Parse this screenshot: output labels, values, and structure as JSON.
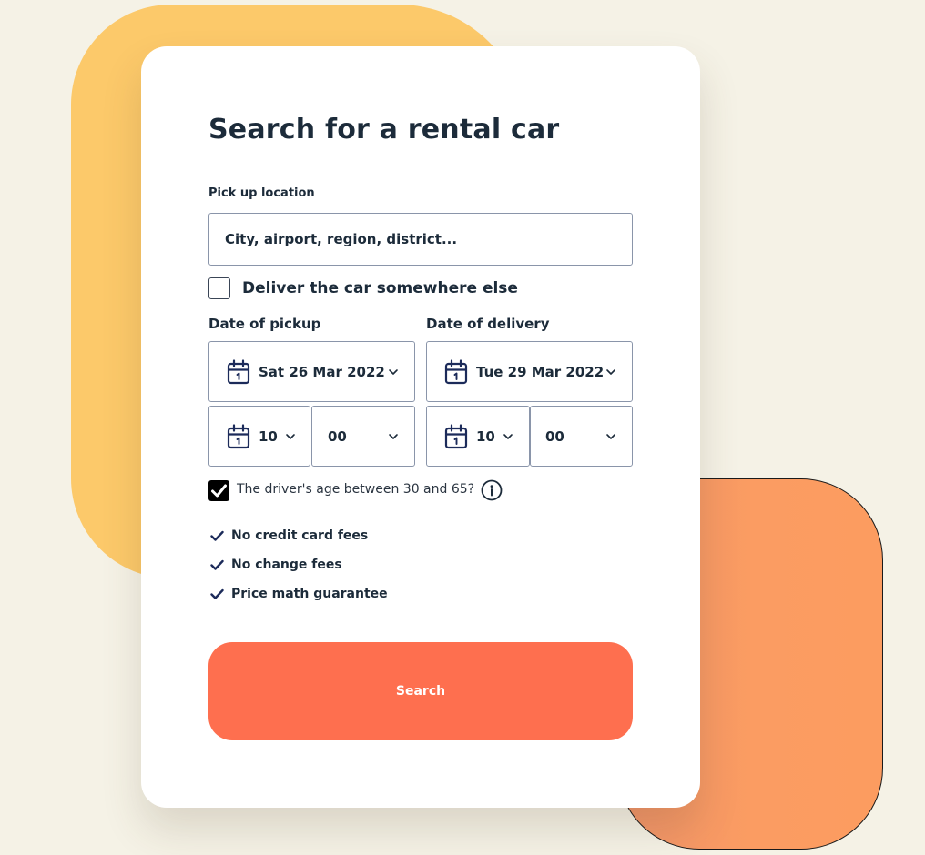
{
  "form": {
    "title": "Search for a rental car",
    "pickup_location": {
      "label": "Pick up location",
      "placeholder": "City, airport, region, district..."
    },
    "deliver_elsewhere": {
      "label": "Deliver the car somewhere else",
      "checked": false
    },
    "pickup": {
      "label": "Date of pickup",
      "date": "Sat 26 Mar 2022",
      "hour": "10",
      "minute": "00"
    },
    "delivery": {
      "label": "Date of delivery",
      "date": "Tue 29 Mar 2022",
      "hour": "10",
      "minute": "00"
    },
    "driver_age": {
      "label": "The driver's age between 30 and 65?",
      "checked": true
    },
    "features": [
      "No credit card fees",
      "No change fees",
      "Price math guarantee"
    ],
    "search_button": "Search"
  },
  "colors": {
    "page_background": "#f5f2e6",
    "yellow_blob": "#fcc96a",
    "orange_blob": "#fb9c62",
    "card": "#ffffff",
    "search_button": "#fe6f4f",
    "text_dark": "#1c2b3a",
    "field_border": "#8a95aa"
  },
  "icons": {
    "date_field": "calendar-icon",
    "dropdown": "chevron-down-icon",
    "info": "info-icon",
    "feature": "checkmark-icon"
  }
}
